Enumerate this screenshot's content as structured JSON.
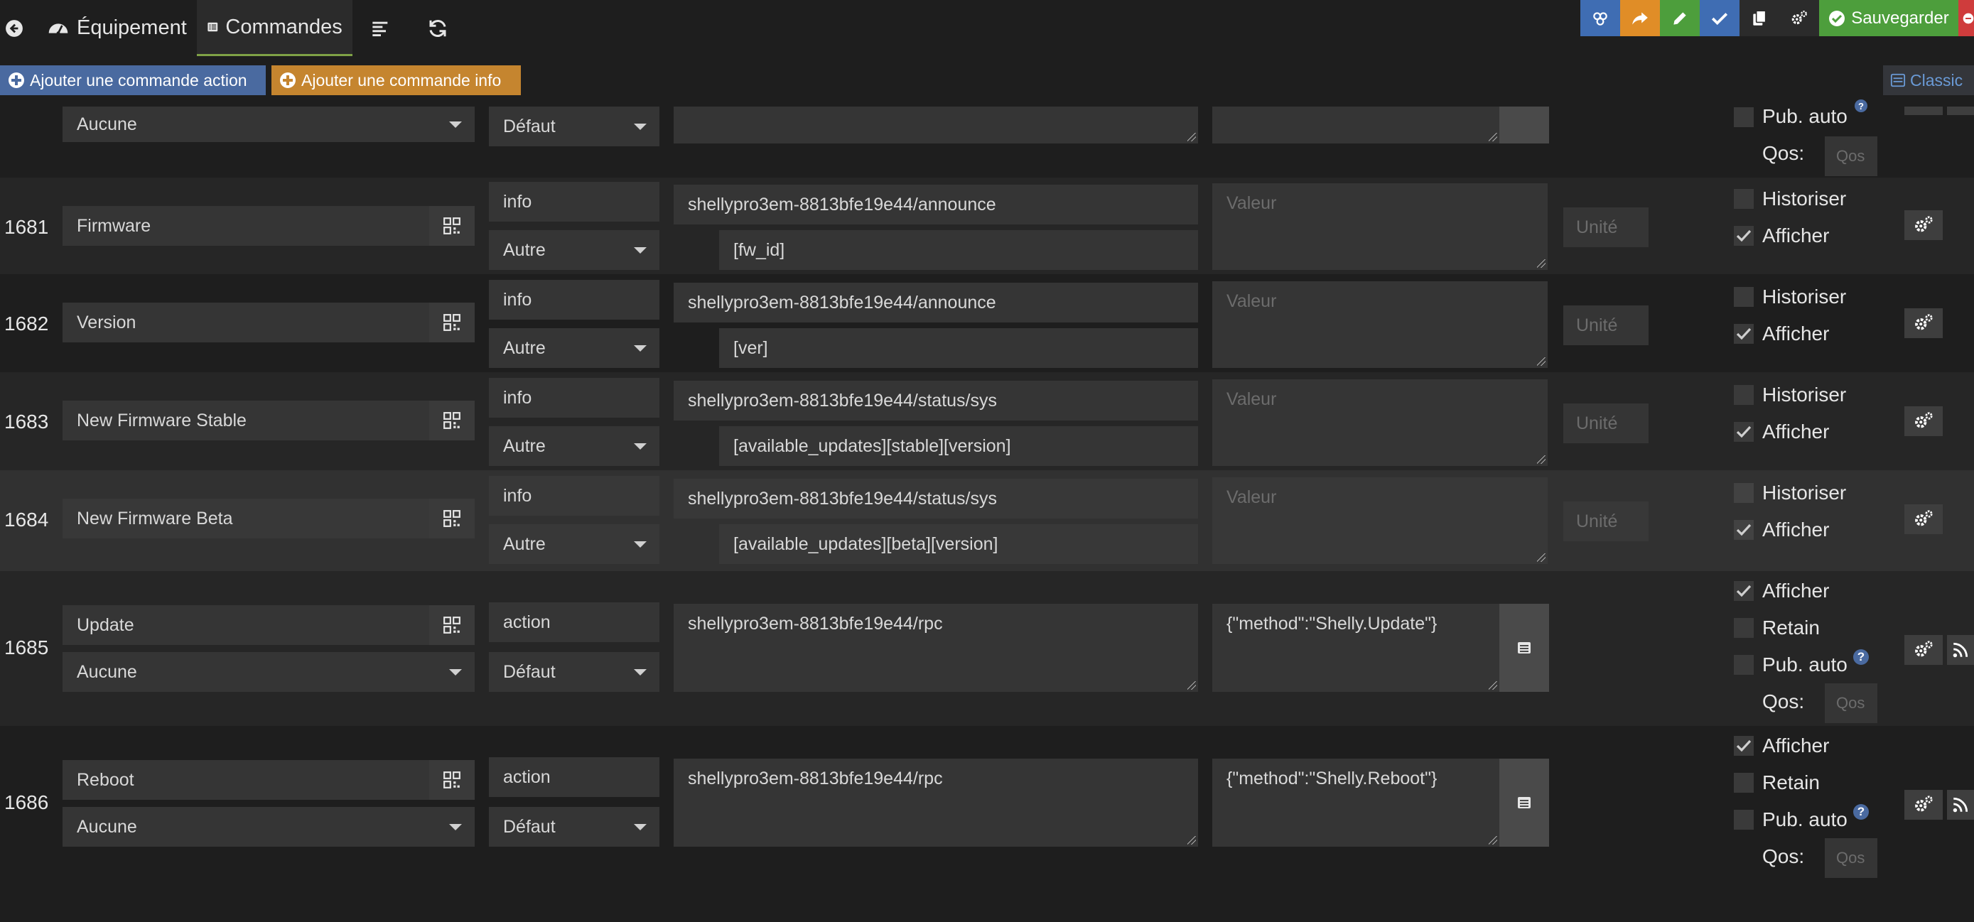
{
  "header": {
    "tabs": [
      {
        "label": "Équipement",
        "icon": "gauge-icon"
      },
      {
        "label": "Commandes",
        "icon": "list-icon"
      }
    ],
    "toolbar": {
      "buttons": [
        {
          "name": "template-button",
          "icon": "template-icon",
          "color": "#3f6db3"
        },
        {
          "name": "duplicate-share-button",
          "icon": "share-icon",
          "color": "#e08d27"
        },
        {
          "name": "rename-button",
          "icon": "pencil-icon",
          "color": "#4d9e3c"
        },
        {
          "name": "check-button",
          "icon": "check-icon",
          "color": "#3f6db3"
        },
        {
          "name": "copy-button",
          "icon": "copy-icon",
          "color": "#2b2b2b"
        },
        {
          "name": "config-button",
          "icon": "gears-icon",
          "color": "#2b2b2b"
        }
      ],
      "save_label": "Sauvegarder",
      "save_color": "#4d9e3c",
      "delete_color": "#cf3c3c"
    }
  },
  "actions": {
    "add_action_label": "Ajouter une commande action",
    "add_info_label": "Ajouter une commande info",
    "classic_label": "Classic"
  },
  "partial_row": {
    "subtype": "Aucune",
    "generic": "Défaut",
    "pub_auto_label": "Pub. auto",
    "qos_label": "Qos:",
    "qos_placeholder": "Qos"
  },
  "commands": [
    {
      "id": "1681",
      "name": "Firmware",
      "type": "info",
      "subtype": "Autre",
      "topic": "shellypro3em-8813bfe19e44/announce",
      "json_path": "[fw_id]",
      "value_placeholder": "Valeur",
      "unit_placeholder": "Unité",
      "historiser_label": "Historiser",
      "historiser": false,
      "afficher_label": "Afficher",
      "afficher": true
    },
    {
      "id": "1682",
      "name": "Version",
      "type": "info",
      "subtype": "Autre",
      "topic": "shellypro3em-8813bfe19e44/announce",
      "json_path": "[ver]",
      "value_placeholder": "Valeur",
      "unit_placeholder": "Unité",
      "historiser_label": "Historiser",
      "historiser": false,
      "afficher_label": "Afficher",
      "afficher": true
    },
    {
      "id": "1683",
      "name": "New Firmware Stable",
      "type": "info",
      "subtype": "Autre",
      "topic": "shellypro3em-8813bfe19e44/status/sys",
      "json_path": "[available_updates][stable][version]",
      "value_placeholder": "Valeur",
      "unit_placeholder": "Unité",
      "historiser_label": "Historiser",
      "historiser": false,
      "afficher_label": "Afficher",
      "afficher": true
    },
    {
      "id": "1684",
      "name": "New Firmware Beta",
      "type": "info",
      "subtype": "Autre",
      "topic": "shellypro3em-8813bfe19e44/status/sys",
      "json_path": "[available_updates][beta][version]",
      "value_placeholder": "Valeur",
      "unit_placeholder": "Unité",
      "historiser_label": "Historiser",
      "historiser": false,
      "afficher_label": "Afficher",
      "afficher": true
    },
    {
      "id": "1685",
      "name": "Update",
      "type": "action",
      "subtype": "Aucune",
      "generic": "Défaut",
      "topic": "shellypro3em-8813bfe19e44/rpc",
      "payload": "{\"method\":\"Shelly.Update\"}",
      "afficher_label": "Afficher",
      "afficher": true,
      "retain_label": "Retain",
      "retain": false,
      "pub_auto_label": "Pub. auto",
      "pub_auto": false,
      "qos_label": "Qos:",
      "qos_placeholder": "Qos"
    },
    {
      "id": "1686",
      "name": "Reboot",
      "type": "action",
      "subtype": "Aucune",
      "generic": "Défaut",
      "topic": "shellypro3em-8813bfe19e44/rpc",
      "payload": "{\"method\":\"Shelly.Reboot\"}",
      "afficher_label": "Afficher",
      "afficher": true,
      "retain_label": "Retain",
      "retain": false,
      "pub_auto_label": "Pub. auto",
      "pub_auto": false,
      "qos_label": "Qos:",
      "qos_placeholder": "Qos"
    }
  ]
}
